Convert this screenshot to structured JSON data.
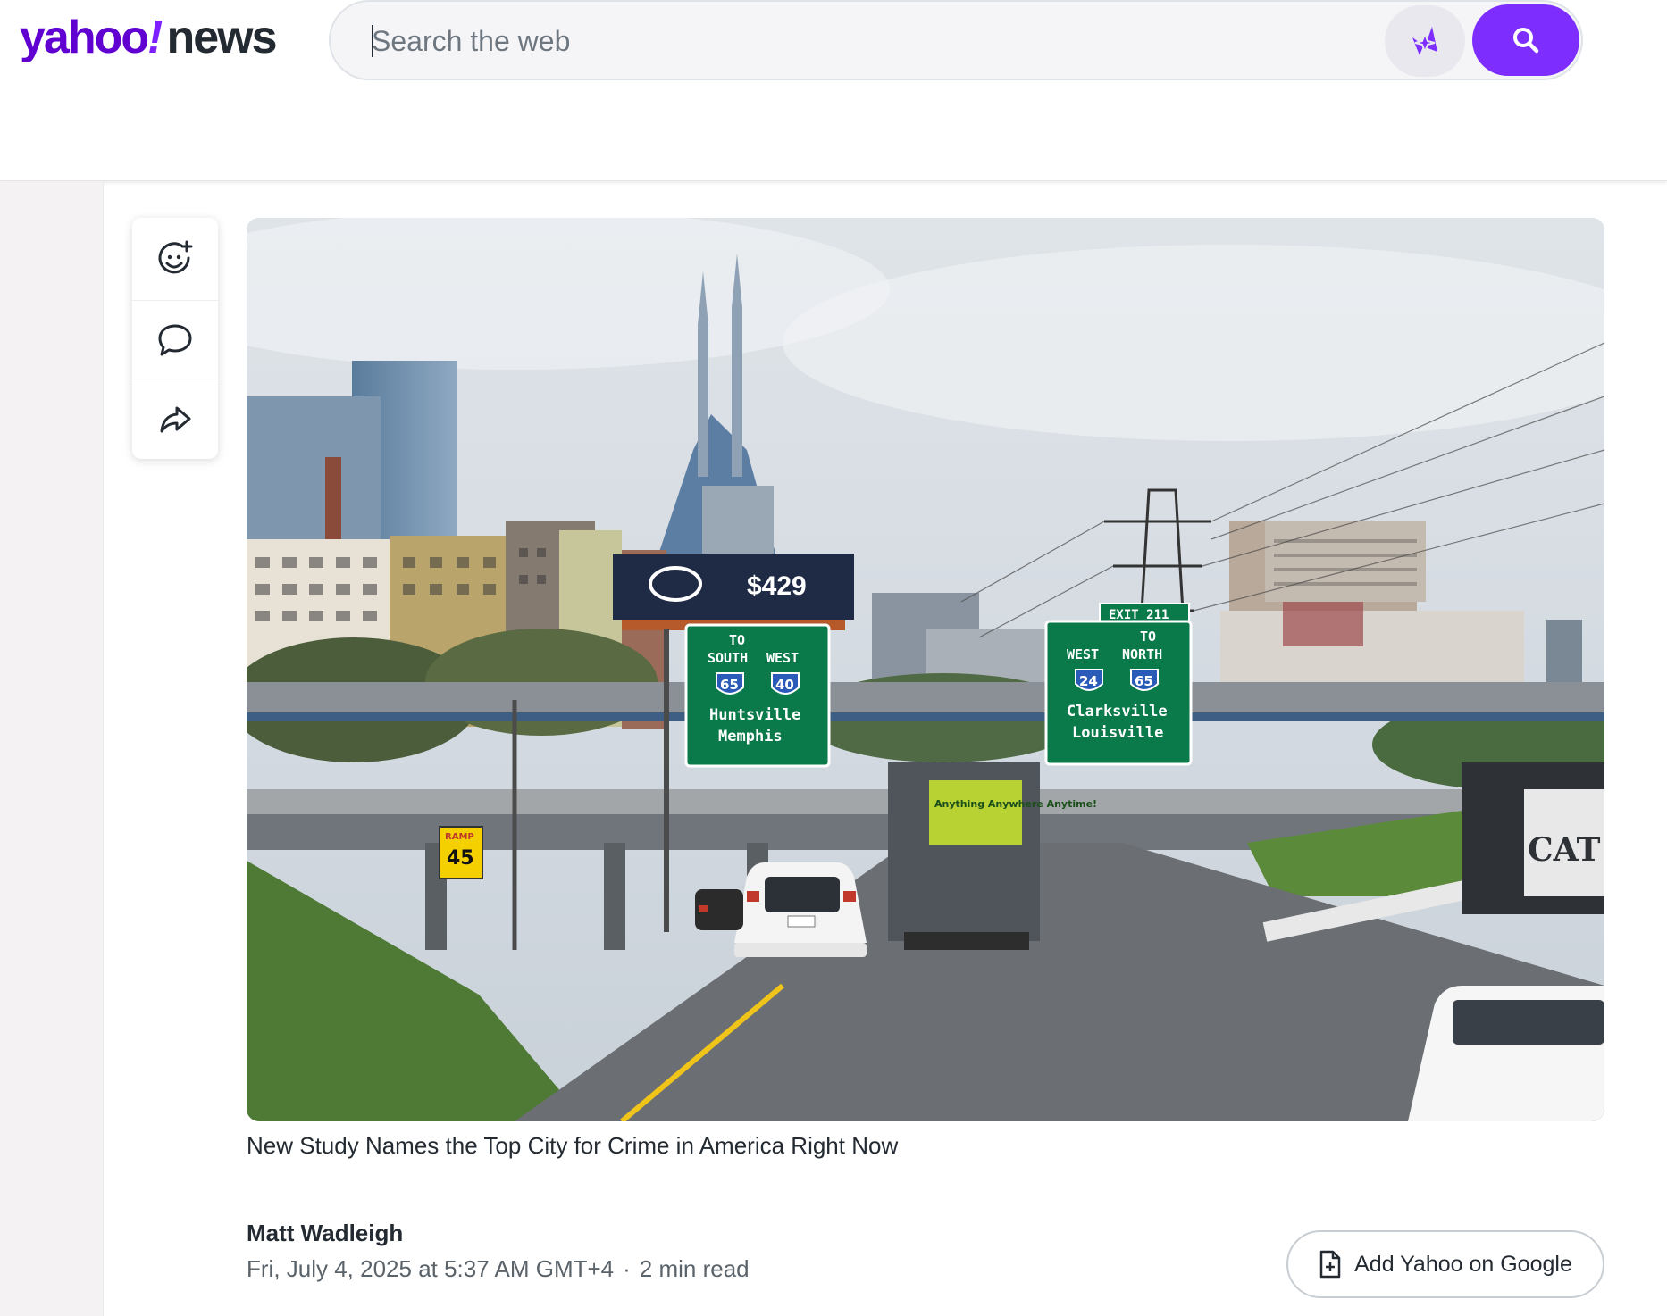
{
  "brand": {
    "logo_main": "yahoo",
    "logo_bang": "!",
    "logo_section": "news",
    "accent": "#6001d2",
    "button_color": "#7d2eff"
  },
  "search": {
    "placeholder": "Search the web",
    "ai_icon": "sparkle-star-icon",
    "search_icon": "magnifier-icon"
  },
  "rail": {
    "actions": [
      {
        "icon": "add-reaction-icon"
      },
      {
        "icon": "comment-bubble-icon"
      },
      {
        "icon": "share-arrow-icon"
      }
    ]
  },
  "article": {
    "image_caption": "New Study Names the Top City for Crime in America Right Now",
    "image_signs": {
      "billboard_price": "$429",
      "left_sign_to": "TO",
      "left_sign_dirs": [
        "SOUTH",
        "WEST"
      ],
      "left_sign_routes": [
        "65",
        "40"
      ],
      "left_sign_cities": [
        "Huntsville",
        "Memphis"
      ],
      "exit_tab": "EXIT 211",
      "right_sign_to": "TO",
      "right_sign_dirs": [
        "WEST",
        "NORTH"
      ],
      "right_sign_routes": [
        "24",
        "65"
      ],
      "right_sign_cities": [
        "Clarksville",
        "Louisville"
      ],
      "ramp_top": "RAMP",
      "ramp_speed": "45",
      "truck_text": "Anything Anywhere Anytime!",
      "truck_brand": "CAT"
    },
    "author": "Matt Wadleigh",
    "date": "Fri, July 4, 2025 at 5:37 AM GMT+4",
    "separator": "·",
    "read_time": "2 min read",
    "add_google_label": "Add Yahoo on Google",
    "add_google_icon": "add-document-icon"
  }
}
